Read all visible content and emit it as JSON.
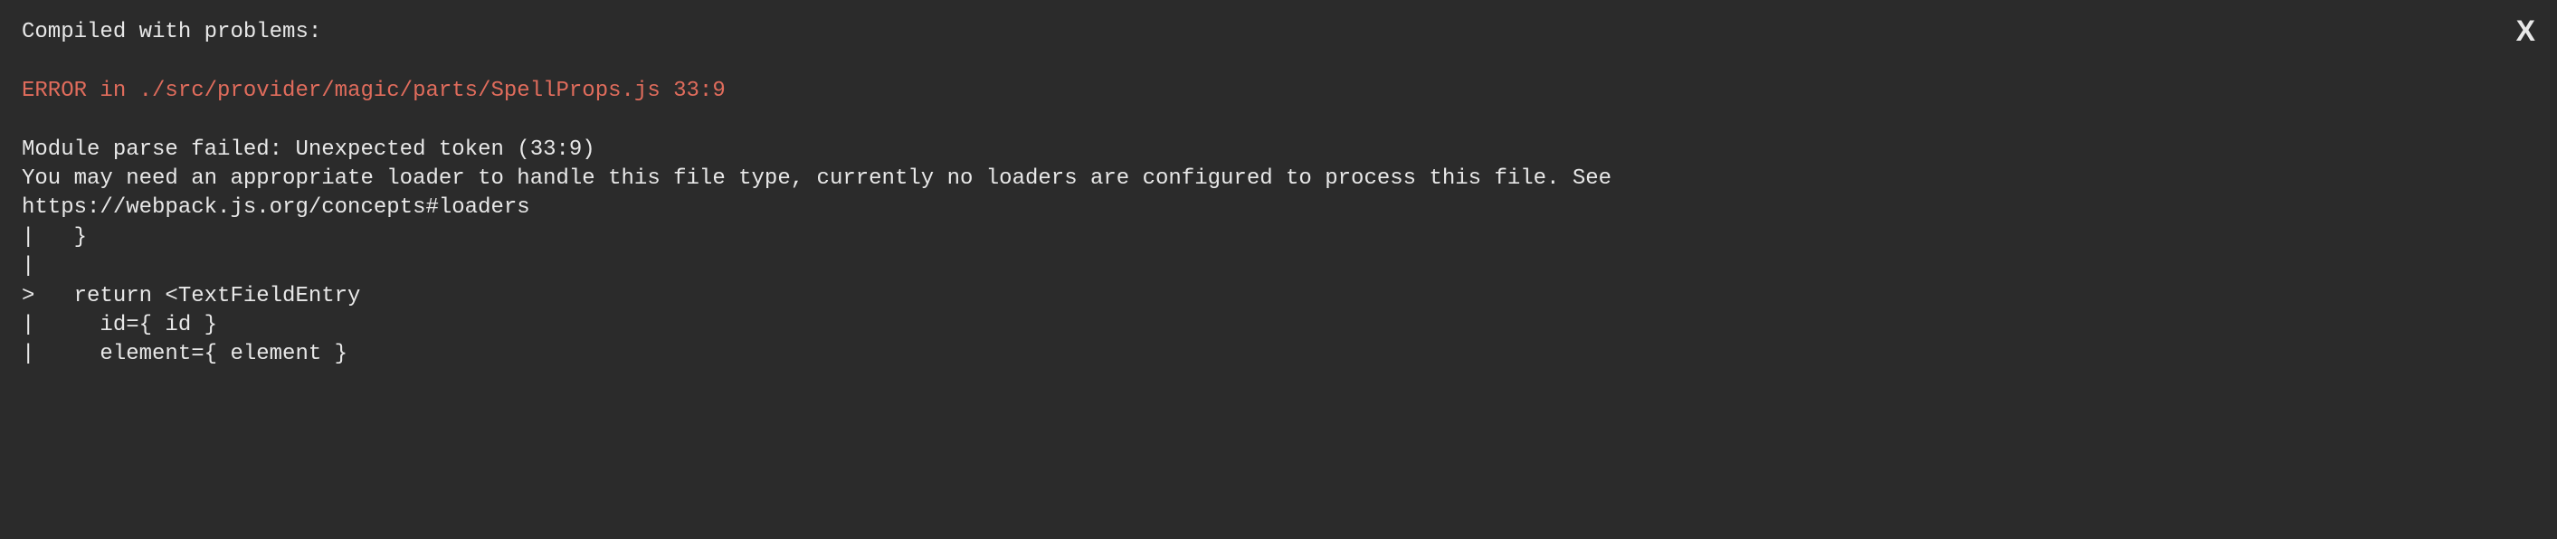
{
  "overlay": {
    "close_label": "X",
    "heading": "Compiled with problems:",
    "error_prefix": "ERROR in ",
    "error_location": "./src/provider/magic/parts/SpellProps.js 33:9",
    "message": "Module parse failed: Unexpected token (33:9)\nYou may need an appropriate loader to handle this file type, currently no loaders are configured to process this file. See\nhttps://webpack.js.org/concepts#loaders",
    "code_snippet": "|   }\n|\n>   return <TextFieldEntry\n|     id={ id }\n|     element={ element }"
  }
}
